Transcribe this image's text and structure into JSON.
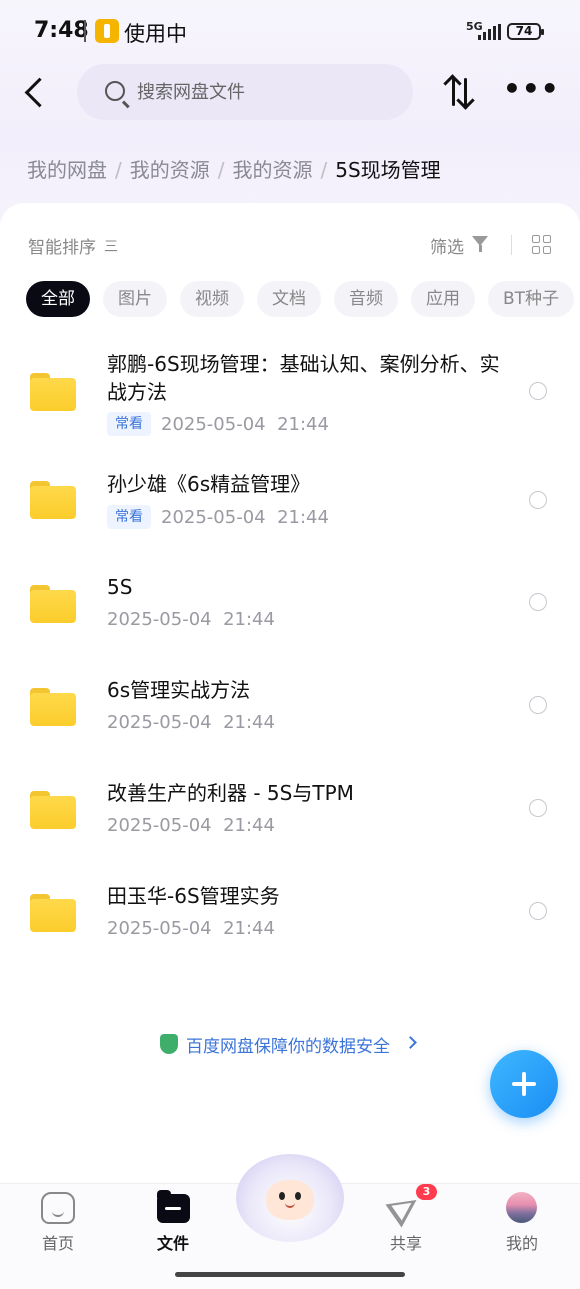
{
  "status": {
    "time": "7:48",
    "app_status": "使用中",
    "network": "5G",
    "battery": "74"
  },
  "search": {
    "placeholder": "搜索网盘文件"
  },
  "breadcrumb": [
    "我的网盘",
    "我的资源",
    "我的资源",
    "5S现场管理"
  ],
  "toolbar": {
    "sort_label": "智能排序",
    "sort_icon_text": "三",
    "filter_label": "筛选"
  },
  "tabs": [
    "全部",
    "图片",
    "视频",
    "文档",
    "音频",
    "应用",
    "BT种子"
  ],
  "active_tab": "全部",
  "files": [
    {
      "name": "郭鹏-6S现场管理：基础认知、案例分析、实战方法",
      "badge": "常看",
      "date": "2025-05-04",
      "time": "21:44"
    },
    {
      "name": "孙少雄《6s精益管理》",
      "badge": "常看",
      "date": "2025-05-04",
      "time": "21:44"
    },
    {
      "name": "5S",
      "badge": "",
      "date": "2025-05-04",
      "time": "21:44"
    },
    {
      "name": "6s管理实战方法",
      "badge": "",
      "date": "2025-05-04",
      "time": "21:44"
    },
    {
      "name": "改善生产的利器 - 5S与TPM",
      "badge": "",
      "date": "2025-05-04",
      "time": "21:44"
    },
    {
      "name": "田玉华-6S管理实务",
      "badge": "",
      "date": "2025-05-04",
      "time": "21:44"
    }
  ],
  "security_notice": "百度网盘保障你的数据安全",
  "bottom_nav": {
    "home": "首页",
    "files": "文件",
    "share": "共享",
    "share_badge": "3",
    "me": "我的"
  },
  "colors": {
    "accent": "#3b74d9",
    "fab": "#1b8ef5",
    "folder": "#fbcd2c",
    "badge_red": "#ff3b4e"
  }
}
